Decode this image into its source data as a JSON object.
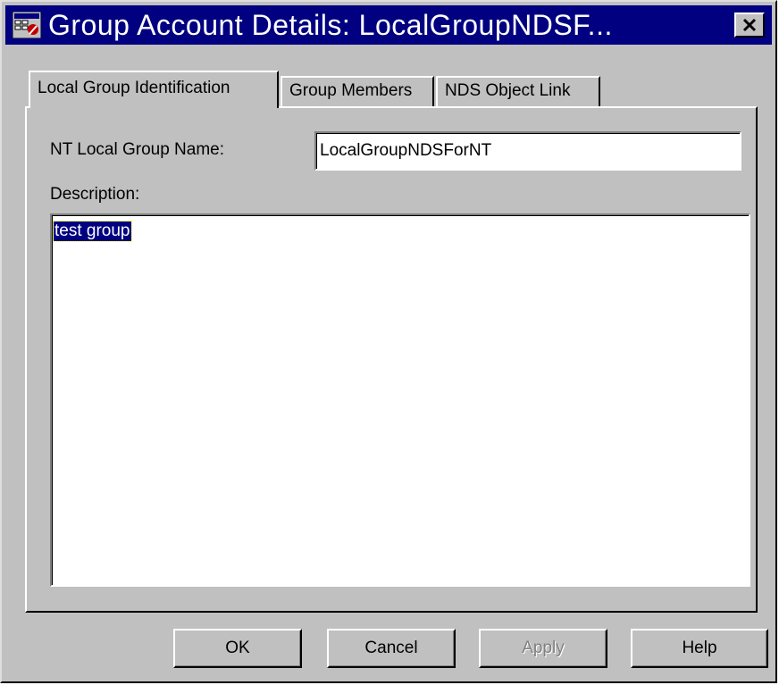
{
  "window": {
    "title": "Group Account Details:  LocalGroupNDSF...",
    "icon": "group-account-icon",
    "close_icon": "close-icon"
  },
  "tabs": [
    {
      "label": "Local Group Identification",
      "active": true
    },
    {
      "label": "Group Members",
      "active": false
    },
    {
      "label": "NDS Object Link",
      "active": false
    }
  ],
  "form": {
    "group_name_label": "NT Local Group Name:",
    "group_name_value": "LocalGroupNDSForNT",
    "description_label": "Description:",
    "description_value": "test group"
  },
  "buttons": {
    "ok": "OK",
    "cancel": "Cancel",
    "apply": "Apply",
    "help": "Help"
  },
  "colors": {
    "title_bar": "#000080",
    "face": "#c0c0c0",
    "selection": "#000080"
  }
}
